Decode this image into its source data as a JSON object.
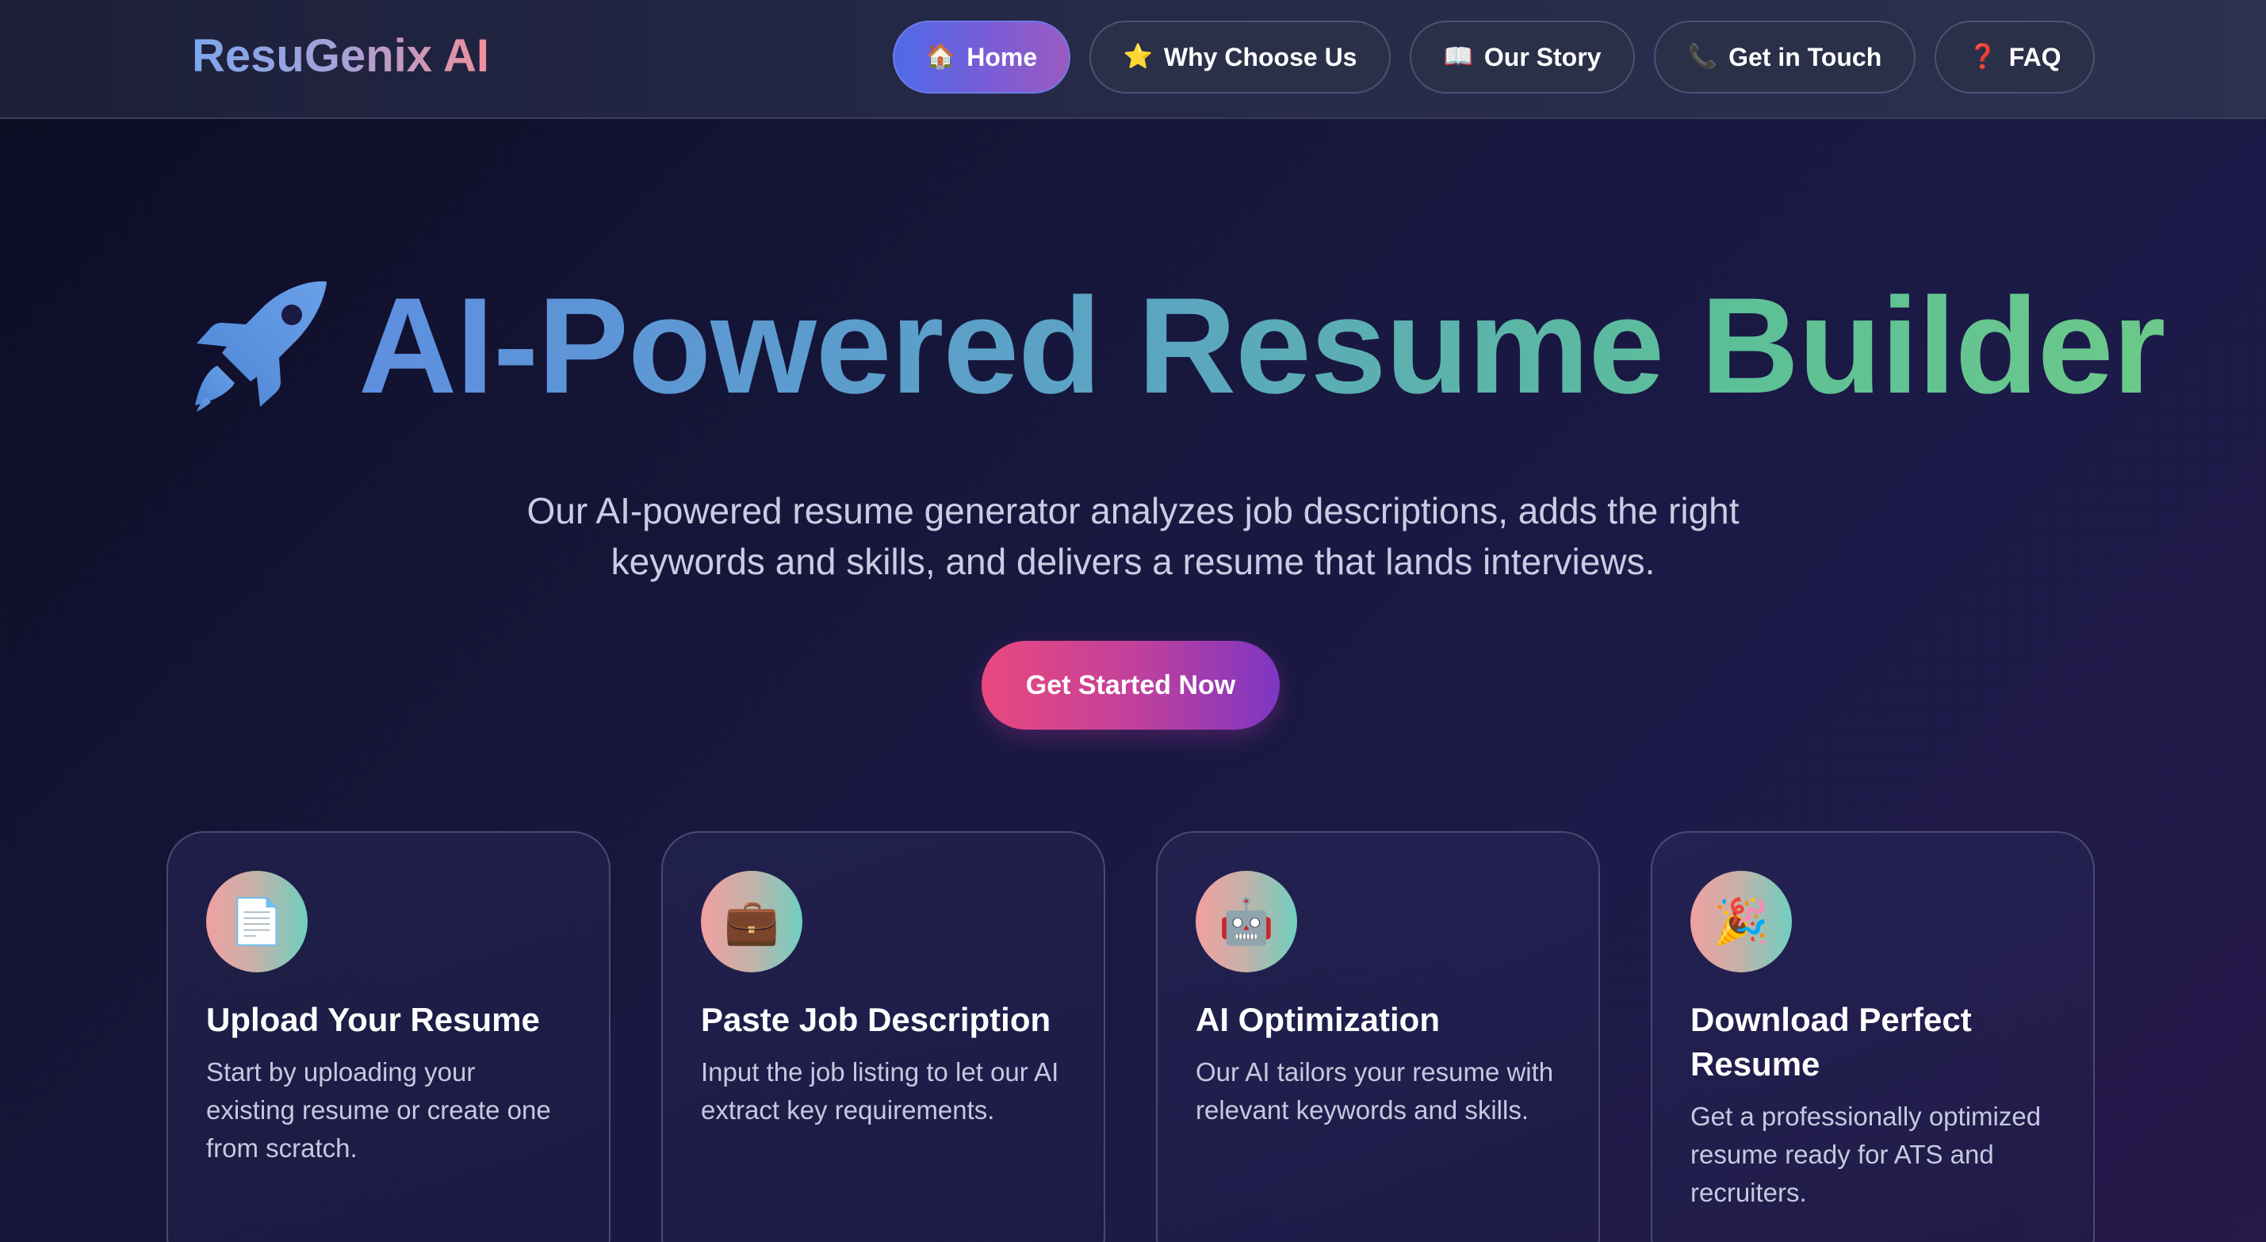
{
  "brand": {
    "name": "ResuGenix AI"
  },
  "nav": {
    "items": [
      {
        "icon": "🏠",
        "label": "Home",
        "active": true
      },
      {
        "icon": "⭐",
        "label": "Why Choose Us",
        "active": false
      },
      {
        "icon": "📖",
        "label": "Our Story",
        "active": false
      },
      {
        "icon": "📞",
        "label": "Get in Touch",
        "active": false
      },
      {
        "icon": "❓",
        "label": "FAQ",
        "active": false
      }
    ]
  },
  "hero": {
    "title": "AI-Powered Resume Builder",
    "subtitle": "Our AI-powered resume generator analyzes job descriptions, adds the right keywords and skills, and delivers a resume that lands interviews.",
    "cta_label": "Get Started Now"
  },
  "features": [
    {
      "icon": "📄",
      "icon_name": "document-icon",
      "title": "Upload Your Resume",
      "description": "Start by uploading your existing resume or create one from scratch."
    },
    {
      "icon": "💼",
      "icon_name": "briefcase-icon",
      "title": "Paste Job Description",
      "description": "Input the job listing to let our AI extract key requirements."
    },
    {
      "icon": "🤖",
      "icon_name": "robot-icon",
      "title": "AI Optimization",
      "description": "Our AI tailors your resume with relevant keywords and skills."
    },
    {
      "icon": "🎉",
      "icon_name": "party-popper-icon",
      "title": "Download Perfect Resume",
      "description": "Get a professionally optimized resume ready for ATS and recruiters."
    }
  ],
  "colors": {
    "accent_blue": "#4f6ae8",
    "accent_pink": "#e9487f",
    "accent_purple": "#7d36c4",
    "title_start": "#5e8fe0",
    "title_end": "#6cc98a"
  }
}
